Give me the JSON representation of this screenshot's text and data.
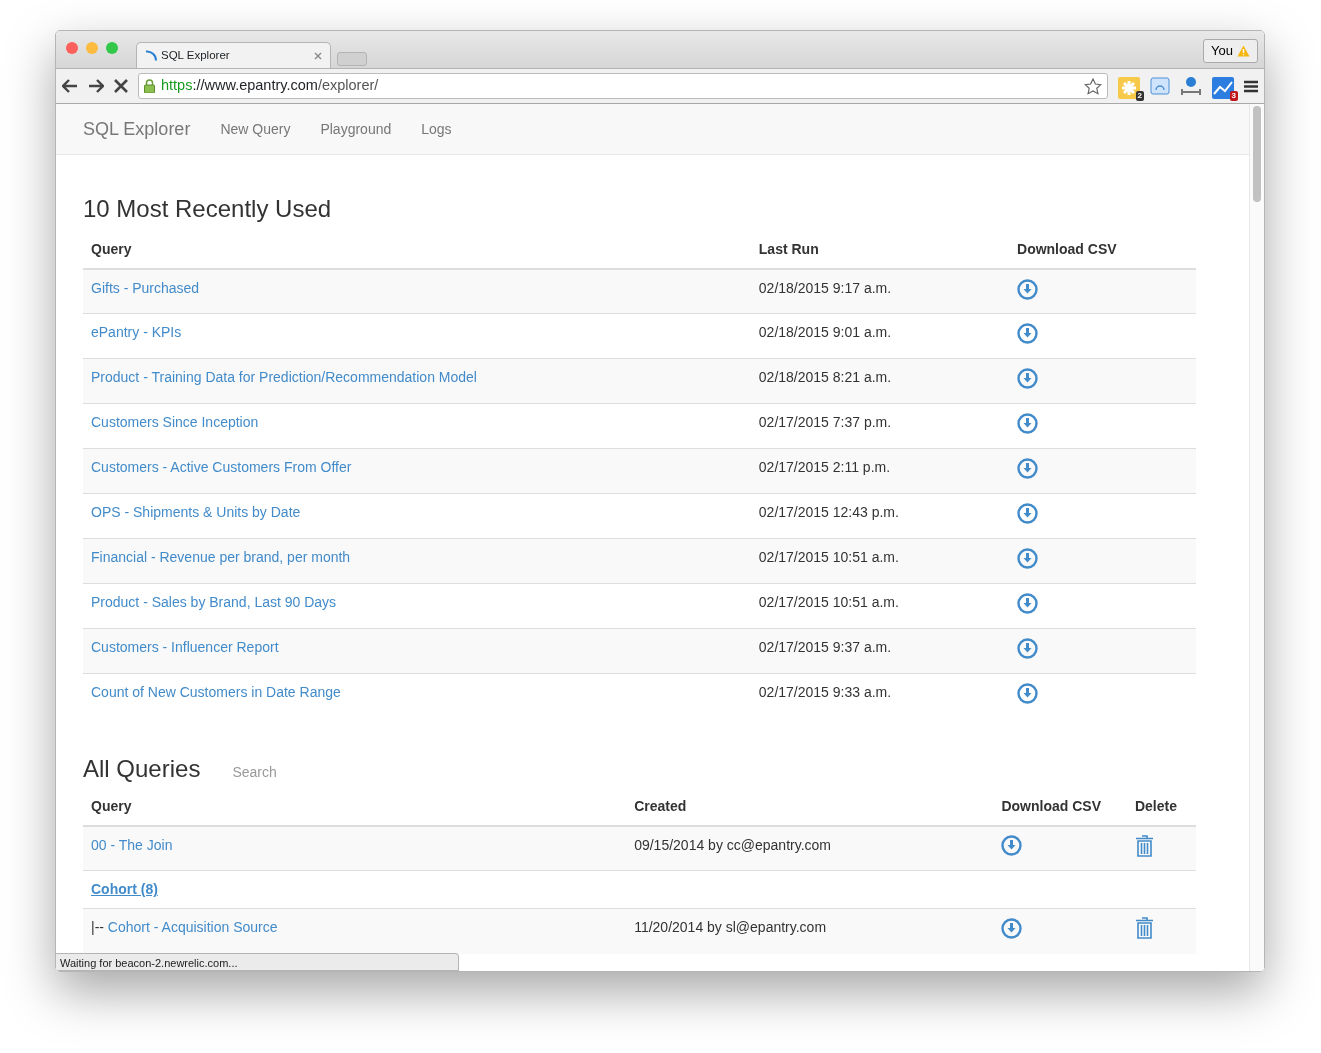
{
  "browser": {
    "tab": {
      "title": "SQL Explorer",
      "loading": true
    },
    "url": {
      "scheme": "https",
      "rest": "://www.epantry.com/explorer/"
    },
    "profile": "You",
    "extension_badges": [
      "2",
      "3"
    ]
  },
  "navbar": {
    "brand": "SQL Explorer",
    "items": [
      "New Query",
      "Playground",
      "Logs"
    ]
  },
  "recent": {
    "title": "10 Most Recently Used",
    "columns": [
      "Query",
      "Last Run",
      "Download CSV"
    ],
    "rows": [
      {
        "query": "Gifts - Purchased",
        "last_run": "02/18/2015 9:17 a.m."
      },
      {
        "query": "ePantry - KPIs",
        "last_run": "02/18/2015 9:01 a.m."
      },
      {
        "query": "Product - Training Data for Prediction/Recommendation Model",
        "last_run": "02/18/2015 8:21 a.m."
      },
      {
        "query": "Customers Since Inception",
        "last_run": "02/17/2015 7:37 p.m."
      },
      {
        "query": "Customers - Active Customers From Offer",
        "last_run": "02/17/2015 2:11 p.m."
      },
      {
        "query": "OPS - Shipments & Units by Date",
        "last_run": "02/17/2015 12:43 p.m."
      },
      {
        "query": "Financial - Revenue per brand, per month",
        "last_run": "02/17/2015 10:51 a.m."
      },
      {
        "query": "Product - Sales by Brand, Last 90 Days",
        "last_run": "02/17/2015 10:51 a.m."
      },
      {
        "query": "Customers - Influencer Report",
        "last_run": "02/17/2015 9:37 a.m."
      },
      {
        "query": "Count of New Customers in Date Range",
        "last_run": "02/17/2015 9:33 a.m."
      }
    ]
  },
  "all": {
    "title": "All Queries",
    "search": {
      "placeholder": "Search"
    },
    "columns": [
      "Query",
      "Created",
      "Download CSV",
      "Delete"
    ],
    "rows": [
      {
        "kind": "query",
        "query": "00 - The Join",
        "created": "09/15/2014 by cc@epantry.com"
      },
      {
        "kind": "folder",
        "label": "Cohort (8)"
      },
      {
        "kind": "child",
        "prefix": "|--",
        "query": "Cohort - Acquisition Source",
        "created": "11/20/2014 by sl@epantry.com"
      }
    ]
  },
  "status_bar": "Waiting for beacon-2.newrelic.com..."
}
